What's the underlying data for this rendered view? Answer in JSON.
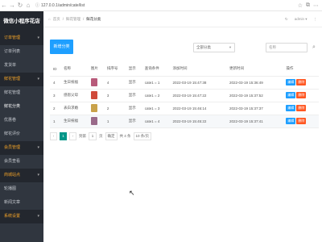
{
  "browser": {
    "url": "127.0.0.1/admin/cate/list",
    "back_icon": "arrow-left",
    "forward_icon": "arrow-right",
    "refresh_icon": "refresh",
    "home_icon": "home"
  },
  "sidebar": {
    "logo": "微信小程序花店",
    "items": [
      {
        "type": "group",
        "label": "订单管理"
      },
      {
        "type": "item",
        "label": "订单列表"
      },
      {
        "type": "item",
        "label": "发货单"
      },
      {
        "type": "group",
        "label": "鲜花管理"
      },
      {
        "type": "item",
        "label": "鲜花管理"
      },
      {
        "type": "item",
        "label": "鲜花分类",
        "active": true
      },
      {
        "type": "item",
        "label": "优惠卷"
      },
      {
        "type": "item",
        "label": "鲜花评价"
      },
      {
        "type": "group",
        "label": "会员管理"
      },
      {
        "type": "item",
        "label": "会员查看"
      },
      {
        "type": "group",
        "label": "商城站点"
      },
      {
        "type": "item",
        "label": "轮播图"
      },
      {
        "type": "item",
        "label": "新闻文章"
      },
      {
        "type": "group",
        "label": "系统设置"
      }
    ]
  },
  "topbar": {
    "crumb_home": "首页",
    "crumb_sep": "/",
    "crumb_mid": "鲜花管理",
    "crumb_current": "鲜花分类",
    "user": "admin",
    "user_caret": "▾"
  },
  "toolbar": {
    "add_label": "新增分类",
    "select_value": "全部分类",
    "search_placeholder": "名称"
  },
  "table": {
    "headers": [
      "ID",
      "名称",
      "图片",
      "排序号",
      "显示",
      "查询条件",
      "添加时间",
      "更新时间",
      "操作"
    ],
    "rows": [
      {
        "id": "4",
        "name": "生日祝福",
        "img_color": "#b85a7a",
        "sort": "4",
        "show": "显示",
        "cond": "cate1 = 1",
        "created": "2022-03-19 15:47:38",
        "updated": "2022-03-19 15:36:49",
        "edit": "编辑",
        "del": "删除"
      },
      {
        "id": "3",
        "name": "感恩父母",
        "img_color": "#d04a3a",
        "sort": "3",
        "show": "显示",
        "cond": "cate1 = 2",
        "created": "2022-03-19 15:47:22",
        "updated": "2022-03-19 15:37:52",
        "edit": "编辑",
        "del": "删除"
      },
      {
        "id": "2",
        "name": "表白求婚",
        "img_color": "#c9a24a",
        "sort": "2",
        "show": "显示",
        "cond": "cate1 = 3",
        "created": "2022-03-19 15:46:14",
        "updated": "2022-03-19 15:37:37",
        "edit": "编辑",
        "del": "删除"
      },
      {
        "id": "1",
        "name": "生日祝福",
        "img_color": "#9a6a8a",
        "sort": "1",
        "show": "显示",
        "cond": "cate1 = 4",
        "created": "2022-03-19 15:45:22",
        "updated": "2022-03-19 15:37:41",
        "edit": "编辑",
        "del": "删除"
      }
    ]
  },
  "pager": {
    "prev": "‹",
    "current": "1",
    "next": "›",
    "goto_label": "到第",
    "goto_value": "1",
    "page_label": "页",
    "confirm": "确定",
    "total": "共 4 条",
    "page_size": "10 条/页"
  }
}
